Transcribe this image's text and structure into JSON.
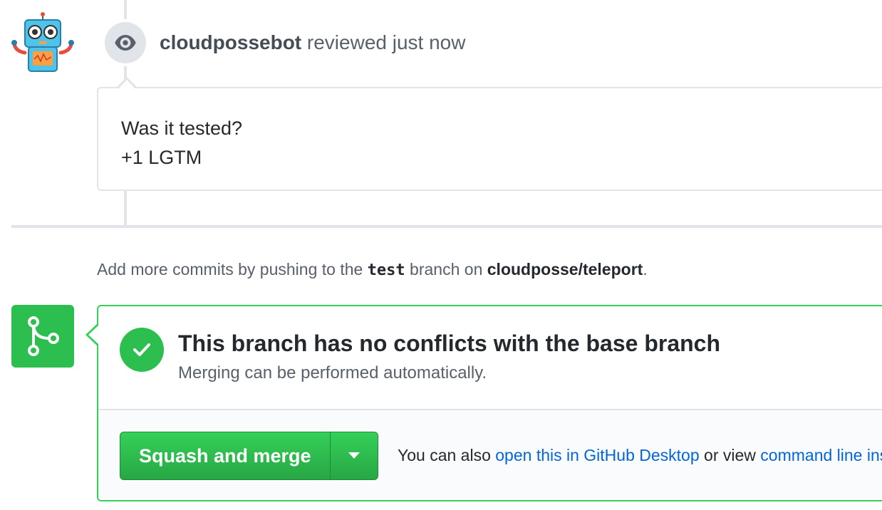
{
  "review": {
    "author": "cloudpossebot",
    "action": " reviewed just now",
    "comment_lines": [
      "Was it tested?",
      "+1 LGTM"
    ]
  },
  "push_hint": {
    "prefix": "Add more commits by pushing to the ",
    "branch": "test",
    "middle": " branch on ",
    "repo": "cloudposse/teleport",
    "suffix": "."
  },
  "merge": {
    "title": "This branch has no conflicts with the base branch",
    "subtitle": "Merging can be performed automatically.",
    "button_label": "Squash and merge",
    "alt_prefix": "You can also ",
    "alt_link1": "open this in GitHub Desktop",
    "alt_middle": " or view ",
    "alt_link2": "command line instructions",
    "alt_suffix": "."
  },
  "colors": {
    "success": "#2cbe4e",
    "link": "#0366d6",
    "muted": "#586069"
  },
  "icons": {
    "review": "eye-icon",
    "merge": "git-merge-icon",
    "status": "check-icon",
    "dropdown": "triangle-down-icon"
  }
}
